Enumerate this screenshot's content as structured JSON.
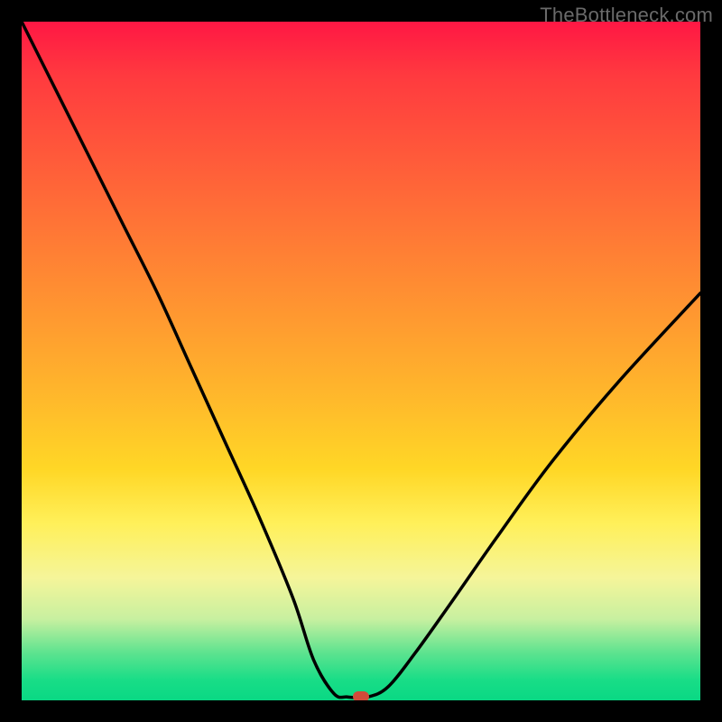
{
  "attribution": "TheBottleneck.com",
  "chart_data": {
    "type": "line",
    "title": "",
    "xlabel": "",
    "ylabel": "",
    "xlim": [
      0,
      100
    ],
    "ylim": [
      0,
      100
    ],
    "series": [
      {
        "name": "bottleneck-curve",
        "x": [
          0,
          5,
          10,
          15,
          20,
          25,
          30,
          35,
          40,
          43,
          46,
          48,
          51,
          54,
          58,
          63,
          70,
          78,
          88,
          100
        ],
        "values": [
          100,
          90,
          80,
          70,
          60,
          49,
          38,
          27,
          15,
          6,
          1,
          0.5,
          0.5,
          2,
          7,
          14,
          24,
          35,
          47,
          60
        ]
      }
    ],
    "marker": {
      "x": 50,
      "y": 0.5,
      "label": "optimal-point"
    }
  },
  "colors": {
    "curve": "#000000",
    "marker": "#d24a3a",
    "frame": "#000000"
  }
}
